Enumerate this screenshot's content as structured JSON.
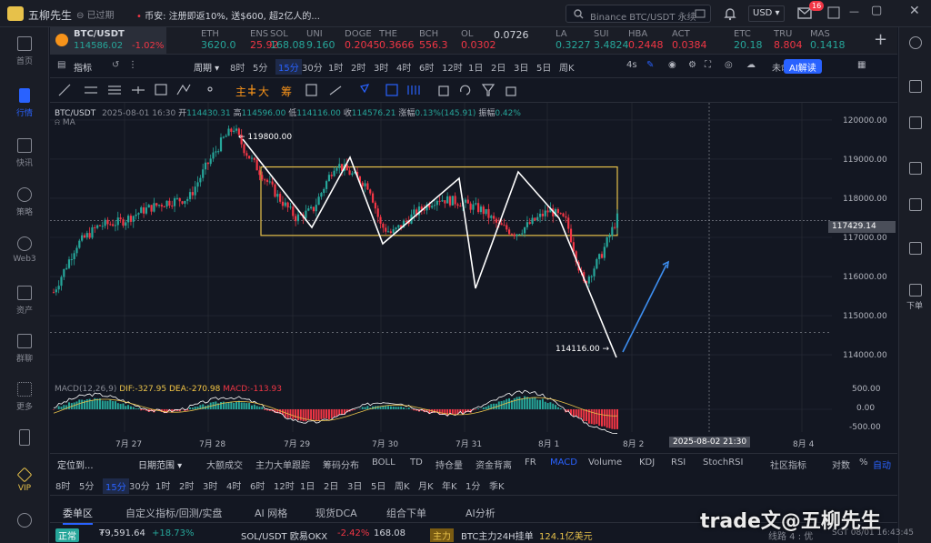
{
  "titlebar": {
    "app_name": "五柳先生",
    "status": "已过期",
    "news": "币安: 注册即返10%, 送$600, 超2亿人的...",
    "search_placeholder": "Binance BTC/USDT 永续",
    "currency": "USD",
    "notif_count": "16"
  },
  "tickers": [
    {
      "name": "BTC/USDT",
      "value": "114586.02",
      "change": "-1.02%",
      "dir": "dn"
    },
    {
      "name": "ETH",
      "value": "3620.0",
      "dir": "up"
    },
    {
      "name": "ENS",
      "value": "25.92",
      "dir": "dn"
    },
    {
      "name": "SOL",
      "value": "168.08",
      "dir": "up"
    },
    {
      "name": "UNI",
      "value": "9.160",
      "dir": "up"
    },
    {
      "name": "DOGE",
      "value": "0.2045",
      "dir": "dn"
    },
    {
      "name": "THE",
      "value": "0.3666",
      "dir": "dn"
    },
    {
      "name": "BCH",
      "value": "556.3",
      "dir": "dn"
    },
    {
      "name": "OL",
      "value": "0.0302",
      "dir": "dn"
    },
    {
      "name": "",
      "value": "0.0726",
      "dir": "nu"
    },
    {
      "name": "LA",
      "value": "0.3227",
      "dir": "up"
    },
    {
      "name": "SUI",
      "value": "3.4824",
      "dir": "up"
    },
    {
      "name": "HBA",
      "value": "0.2448",
      "dir": "dn"
    },
    {
      "name": "ACT",
      "value": "0.0384",
      "dir": "dn"
    },
    {
      "name": "ETC",
      "value": "20.18",
      "dir": "up"
    },
    {
      "name": "TRU",
      "value": "8.804",
      "dir": "dn"
    },
    {
      "name": "MAS",
      "value": "0.1418",
      "dir": "up"
    }
  ],
  "toolbar1": {
    "indicator": "指标",
    "period": "周期",
    "intervals": [
      "8时",
      "5分",
      "15分",
      "30分",
      "1时",
      "2时",
      "3时",
      "4时",
      "6时",
      "12时",
      "1日",
      "2日",
      "3日",
      "5日",
      "周K"
    ],
    "selected": "15分",
    "right_4s": "4s",
    "unnamed": "未命名",
    "ai": "AI解读"
  },
  "toolbar2": {
    "labels": [
      "主",
      "大",
      "筹"
    ]
  },
  "sidebar": {
    "items": [
      {
        "label": "首页"
      },
      {
        "label": "行情"
      },
      {
        "label": "快讯"
      },
      {
        "label": "策略"
      },
      {
        "label": "Web3"
      },
      {
        "label": "资产"
      },
      {
        "label": "群聊"
      },
      {
        "label": "更多"
      },
      {
        "label": ""
      },
      {
        "label": "VIP"
      },
      {
        "label": ""
      }
    ]
  },
  "rightbar": {
    "label": "下单"
  },
  "chart_info": {
    "symbol": "BTC/USDT",
    "datetime": "2025-08-01 16:30",
    "open_label": "开",
    "open": "114430.31",
    "high_label": "高",
    "high": "114596.00",
    "low_label": "低",
    "low": "114116.00",
    "close_label": "收",
    "close": "114576.21",
    "change_label": "涨幅",
    "change": "0.13%(145.91)",
    "amp_label": "振幅",
    "amp": "0.42%",
    "ma": "MA",
    "high_mark": "← 119800.00",
    "low_mark": "114116.00 →",
    "price_tag": "117429.14",
    "date_tag": "2025-08-02 21:30",
    "macd_label": "MACD(12,26,9)",
    "dif": "DIF:-327.95",
    "dea": "DEA:-270.98",
    "macd": "MACD:-113.93",
    "sub_y": [
      "500.00",
      "0.00",
      "-500.00"
    ]
  },
  "chart_data": {
    "type": "candlestick",
    "y_axis_ticks": [
      "120000.00",
      "119000.00",
      "118000.00",
      "117000.00",
      "116000.00",
      "115000.00",
      "114000.00"
    ],
    "ylim": [
      113700,
      120300
    ],
    "x_ticks": [
      "7月 27",
      "7月 28",
      "7月 29",
      "7月 30",
      "7月 31",
      "8月 1",
      "8月 2",
      "8月 4"
    ],
    "annotation_range": [
      117050,
      118800
    ],
    "price_path": [
      [
        0,
        115600
      ],
      [
        0.04,
        116800
      ],
      [
        0.08,
        117300
      ],
      [
        0.12,
        117400
      ],
      [
        0.16,
        117700
      ],
      [
        0.2,
        117900
      ],
      [
        0.24,
        118000
      ],
      [
        0.27,
        118800
      ],
      [
        0.3,
        119500
      ],
      [
        0.32,
        119800
      ],
      [
        0.34,
        119200
      ],
      [
        0.37,
        118600
      ],
      [
        0.4,
        118000
      ],
      [
        0.43,
        117500
      ],
      [
        0.46,
        117700
      ],
      [
        0.5,
        118900
      ],
      [
        0.53,
        118600
      ],
      [
        0.56,
        118300
      ],
      [
        0.58,
        117300
      ],
      [
        0.6,
        117100
      ],
      [
        0.64,
        117600
      ],
      [
        0.68,
        118000
      ],
      [
        0.72,
        117900
      ],
      [
        0.76,
        117700
      ],
      [
        0.79,
        117300
      ],
      [
        0.82,
        117100
      ],
      [
        0.85,
        117400
      ],
      [
        0.88,
        117700
      ],
      [
        0.91,
        117400
      ],
      [
        0.94,
        115800
      ],
      [
        0.97,
        116500
      ],
      [
        1.0,
        117500
      ]
    ]
  },
  "bottom": {
    "locate": "定位到...",
    "range": "日期范围",
    "items": [
      "大额成交",
      "主力大单跟踪",
      "筹码分布",
      "BOLL",
      "TD",
      "持仓量",
      "资金背离",
      "FR",
      "MACD",
      "Volume",
      "KDJ",
      "RSI",
      "StochRSI"
    ],
    "indicators_label": "社区指标",
    "log": "对数",
    "pct": "%",
    "auto": "自动",
    "intervals": [
      "8时",
      "5分",
      "15分",
      "30分",
      "1时",
      "2时",
      "3时",
      "4时",
      "6时",
      "12时",
      "1日",
      "2日",
      "3日",
      "5日",
      "周K",
      "月K",
      "年K",
      "1分",
      "季K"
    ],
    "tabs": [
      "委单区",
      "自定义指标/回测/实盘",
      "AI 网格",
      "现货DCA",
      "组合下单",
      "AI分析"
    ]
  },
  "status": {
    "state": "正常",
    "balance": "₮9,591.64",
    "pnl": "+18.73%",
    "pair": "SOL/USDT 欧易OKX",
    "pair_change": "-2.42%",
    "pair_price": "168.08",
    "main_label": "主力",
    "main_flow": "BTC主力24H挂单",
    "main_value": "124.1亿美元",
    "line": "线路 4 : 优",
    "time": "SGT 08/01 16:43:45"
  },
  "watermark": "trade文@五柳先生"
}
